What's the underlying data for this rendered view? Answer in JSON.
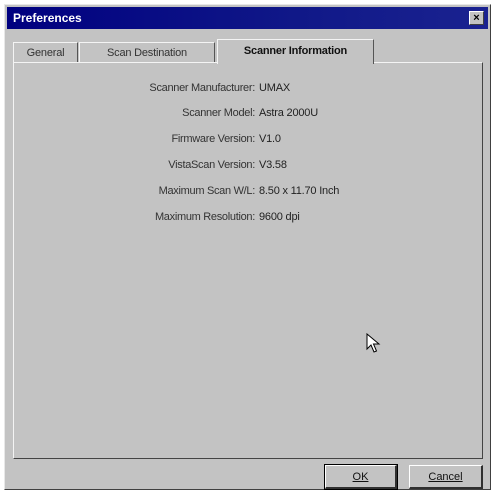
{
  "window": {
    "title": "Preferences",
    "close_glyph": "×"
  },
  "tabs": [
    {
      "label": "General",
      "active": false
    },
    {
      "label": "Scan Destination",
      "active": false
    },
    {
      "label": "Scanner Information",
      "active": true
    }
  ],
  "scanner_info": [
    {
      "label": "Scanner Manufacturer:",
      "value": "UMAX"
    },
    {
      "label": "Scanner Model:",
      "value": "Astra 2000U"
    },
    {
      "label": "Firmware Version:",
      "value": "V1.0"
    },
    {
      "label": "VistaScan Version:",
      "value": "V3.58"
    },
    {
      "label": "Maximum Scan W/L:",
      "value": "8.50 x 11.70 Inch"
    },
    {
      "label": "Maximum Resolution:",
      "value": "9600 dpi"
    }
  ],
  "buttons": {
    "ok_label": "OK",
    "cancel_label": "Cancel"
  }
}
